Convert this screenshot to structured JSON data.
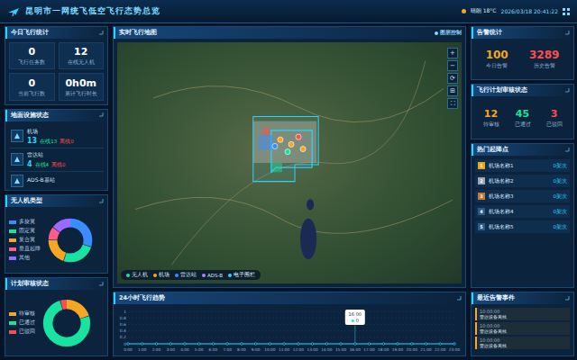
{
  "header": {
    "title": "昆明市一网统飞低空飞行态势总览",
    "weather": "晴朗 18°C",
    "datetime": "2026/03/18 20:41:22"
  },
  "flight_stats": {
    "title": "今日飞行统计",
    "items": [
      {
        "value": "0",
        "label": "飞行任务数"
      },
      {
        "value": "12",
        "label": "在线无人机"
      },
      {
        "value": "0",
        "label": "当前飞行数"
      },
      {
        "value": "0h0m",
        "label": "累计飞行时长"
      }
    ]
  },
  "facilities": {
    "title": "地面设施状态",
    "items": [
      {
        "name": "机场",
        "count": "13",
        "online": "在线13",
        "offline": "离线0"
      },
      {
        "name": "雷达站",
        "count": "4",
        "online": "在线4",
        "offline": "离线0"
      },
      {
        "name": "ADS-B基站",
        "count": "",
        "online": "",
        "offline": ""
      }
    ]
  },
  "drone_types": {
    "title": "无人机类型",
    "items": [
      {
        "label": "多旋翼",
        "value": 30,
        "color": "#3b8cff"
      },
      {
        "label": "固定翼",
        "value": 25,
        "color": "#19e3a0"
      },
      {
        "label": "复合翼",
        "value": 20,
        "color": "#f5a623"
      },
      {
        "label": "垂直起降",
        "value": 10,
        "color": "#ff5c8a"
      },
      {
        "label": "其他",
        "value": 15,
        "color": "#9b6bff"
      }
    ]
  },
  "plan_review": {
    "title": "计划审核状态",
    "items": [
      {
        "label": "待审核",
        "value": 12,
        "color": "#f5a623"
      },
      {
        "label": "已通过",
        "value": 45,
        "color": "#19e3a0"
      },
      {
        "label": "已驳回",
        "value": 3,
        "color": "#ff4d4f"
      }
    ]
  },
  "map": {
    "title": "实时飞行地图",
    "layer_button": "图层控制",
    "tools": [
      "+",
      "−",
      "⟳",
      "⊞",
      "⛶"
    ],
    "legend": [
      {
        "label": "无人机",
        "color": "#19e3a0"
      },
      {
        "label": "机场",
        "color": "#f5a623"
      },
      {
        "label": "雷达站",
        "color": "#3b8cff"
      },
      {
        "label": "ADS-B",
        "color": "#b57bff"
      },
      {
        "label": "电子围栏",
        "color": "#2ad4ff"
      }
    ]
  },
  "trend": {
    "title": "24小时飞行趋势",
    "y_ticks": [
      "1",
      "0.8",
      "0.6",
      "0.4",
      "0.2",
      "0"
    ],
    "x_ticks": [
      "0:00",
      "1:00",
      "2:00",
      "3:00",
      "4:00",
      "5:00",
      "6:00",
      "7:00",
      "8:00",
      "9:00",
      "10:00",
      "11:00",
      "12:00",
      "13:00",
      "14:00",
      "15:00",
      "16:00",
      "17:00",
      "18:00",
      "19:00",
      "20:00",
      "21:00",
      "22:00",
      "23:00"
    ],
    "values": [
      0,
      0,
      0,
      0,
      0,
      0,
      0,
      0,
      0,
      0,
      0,
      0,
      0,
      0,
      0,
      0,
      0,
      0,
      0,
      0,
      0,
      0,
      0,
      0
    ],
    "tooltip": {
      "time": "16:00",
      "value": "0"
    }
  },
  "alarms": {
    "title": "告警统计",
    "items": [
      {
        "value": "100",
        "label": "今日告警",
        "color": "#f5a623"
      },
      {
        "value": "3289",
        "label": "历史告警",
        "color": "#ff4d4f"
      }
    ]
  },
  "plan_status": {
    "title": "飞行计划审核状态",
    "items": [
      {
        "value": "12",
        "label": "待审核",
        "color": "#f5a623"
      },
      {
        "value": "45",
        "label": "已通过",
        "color": "#19e3a0"
      },
      {
        "value": "3",
        "label": "已驳回",
        "color": "#ff4d4f"
      }
    ]
  },
  "hot_spots": {
    "title": "热门起降点",
    "items": [
      {
        "rank": "1",
        "name": "机场名称1",
        "count": "0架次",
        "color": "#e6a817"
      },
      {
        "rank": "2",
        "name": "机场名称2",
        "count": "0架次",
        "color": "#9aa7b8"
      },
      {
        "rank": "3",
        "name": "机场名称3",
        "count": "0架次",
        "color": "#c0783a"
      },
      {
        "rank": "4",
        "name": "机场名称4",
        "count": "0架次",
        "color": "#2a5a86"
      },
      {
        "rank": "5",
        "name": "机场名称5",
        "count": "0架次",
        "color": "#2a5a86"
      }
    ]
  },
  "events": {
    "title": "最近告警事件",
    "items": [
      {
        "time": "10:00:00",
        "text": "雷达设备离线"
      },
      {
        "time": "10:00:00",
        "text": "雷达设备离线"
      },
      {
        "time": "10:00:00",
        "text": "雷达设备离线"
      }
    ]
  }
}
